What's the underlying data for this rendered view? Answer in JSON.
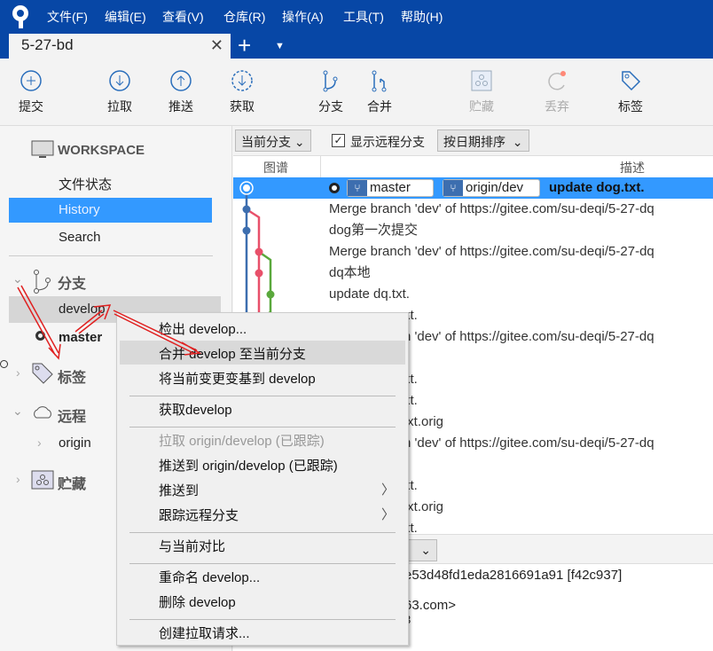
{
  "app": {
    "menu": [
      "文件(F)",
      "编辑(E)",
      "查看(V)",
      "仓库(R)",
      "操作(A)",
      "工具(T)",
      "帮助(H)"
    ],
    "tab_title": "5-27-bd"
  },
  "toolbar": [
    {
      "label": "提交",
      "icon": "plus-circle-icon"
    },
    {
      "label": "拉取",
      "icon": "arrow-down-circle-icon"
    },
    {
      "label": "推送",
      "icon": "arrow-up-circle-icon"
    },
    {
      "label": "获取",
      "icon": "fetch-dashed-circle-icon"
    },
    {
      "label": "分支",
      "icon": "branch-icon"
    },
    {
      "label": "合并",
      "icon": "merge-icon"
    },
    {
      "label": "贮藏",
      "icon": "stash-icon",
      "disabled": true
    },
    {
      "label": "丢弃",
      "icon": "discard-icon",
      "disabled": true
    },
    {
      "label": "标签",
      "icon": "tag-icon"
    }
  ],
  "sidebar": {
    "workspace": "WORKSPACE",
    "items": [
      "文件状态",
      "History",
      "Search"
    ],
    "selected": "History",
    "branches_label": "分支",
    "branches": [
      "develop",
      "master"
    ],
    "current_branch": "master",
    "tags_label": "标签",
    "remotes_label": "远程",
    "remotes": [
      "origin"
    ],
    "stashes_label": "贮藏"
  },
  "filters": {
    "branch_filter": "当前分支",
    "show_remote": "显示远程分支",
    "show_remote_checked": true,
    "sort": "按日期排序"
  },
  "columns": {
    "graph": "图谱",
    "desc": "描述"
  },
  "commits": [
    {
      "tags": [
        "master",
        "origin/dev"
      ],
      "msg": "update dog.txt."
    },
    {
      "msg": "Merge branch 'dev' of https://gitee.com/su-deqi/5-27-dq"
    },
    {
      "msg": "dog第一次提交"
    },
    {
      "msg": "Merge branch 'dev' of https://gitee.com/su-deqi/5-27-dq"
    },
    {
      "msg": "dq本地"
    },
    {
      "msg": "update dq.txt."
    },
    {
      "msg": "xt."
    },
    {
      "msg": "h 'dev' of https://gitee.com/su-deqi/5-27-dq"
    },
    {
      "msg": ""
    },
    {
      "msg": "xt."
    },
    {
      "msg": "xt."
    },
    {
      "msg": "txt.orig"
    },
    {
      "msg": "h 'dev' of https://gitee.com/su-deqi/5-27-dq"
    },
    {
      "msg": ""
    },
    {
      "msg": "xt."
    },
    {
      "msg": "txt.orig"
    },
    {
      "msg": "xt."
    }
  ],
  "details": {
    "hash": "e53d48fd1eda2816691a91 [f42c937]",
    "email": "63.com>",
    "extra": "3"
  },
  "context_menu": [
    {
      "label": "检出 develop..."
    },
    {
      "label": "合并 develop 至当前分支",
      "highlighted": true
    },
    {
      "label": "将当前变更变基到 develop"
    },
    {
      "sep": true
    },
    {
      "label": "获取develop"
    },
    {
      "sep": true
    },
    {
      "label": "拉取 origin/develop (已跟踪)",
      "disabled": true
    },
    {
      "label": "推送到 origin/develop (已跟踪)"
    },
    {
      "label": "推送到",
      "submenu": true
    },
    {
      "label": "跟踪远程分支",
      "submenu": true
    },
    {
      "sep": true
    },
    {
      "label": "与当前对比"
    },
    {
      "sep": true
    },
    {
      "label": "重命名 develop..."
    },
    {
      "label": "删除 develop"
    },
    {
      "sep": true
    },
    {
      "label": "创建拉取请求..."
    }
  ],
  "colors": {
    "titlebar": "#0747a6",
    "selection": "#3399ff",
    "graph_blue": "#3d6eaf",
    "graph_red": "#e8506a",
    "graph_green": "#5aa83c",
    "annotation": "#e02020"
  }
}
